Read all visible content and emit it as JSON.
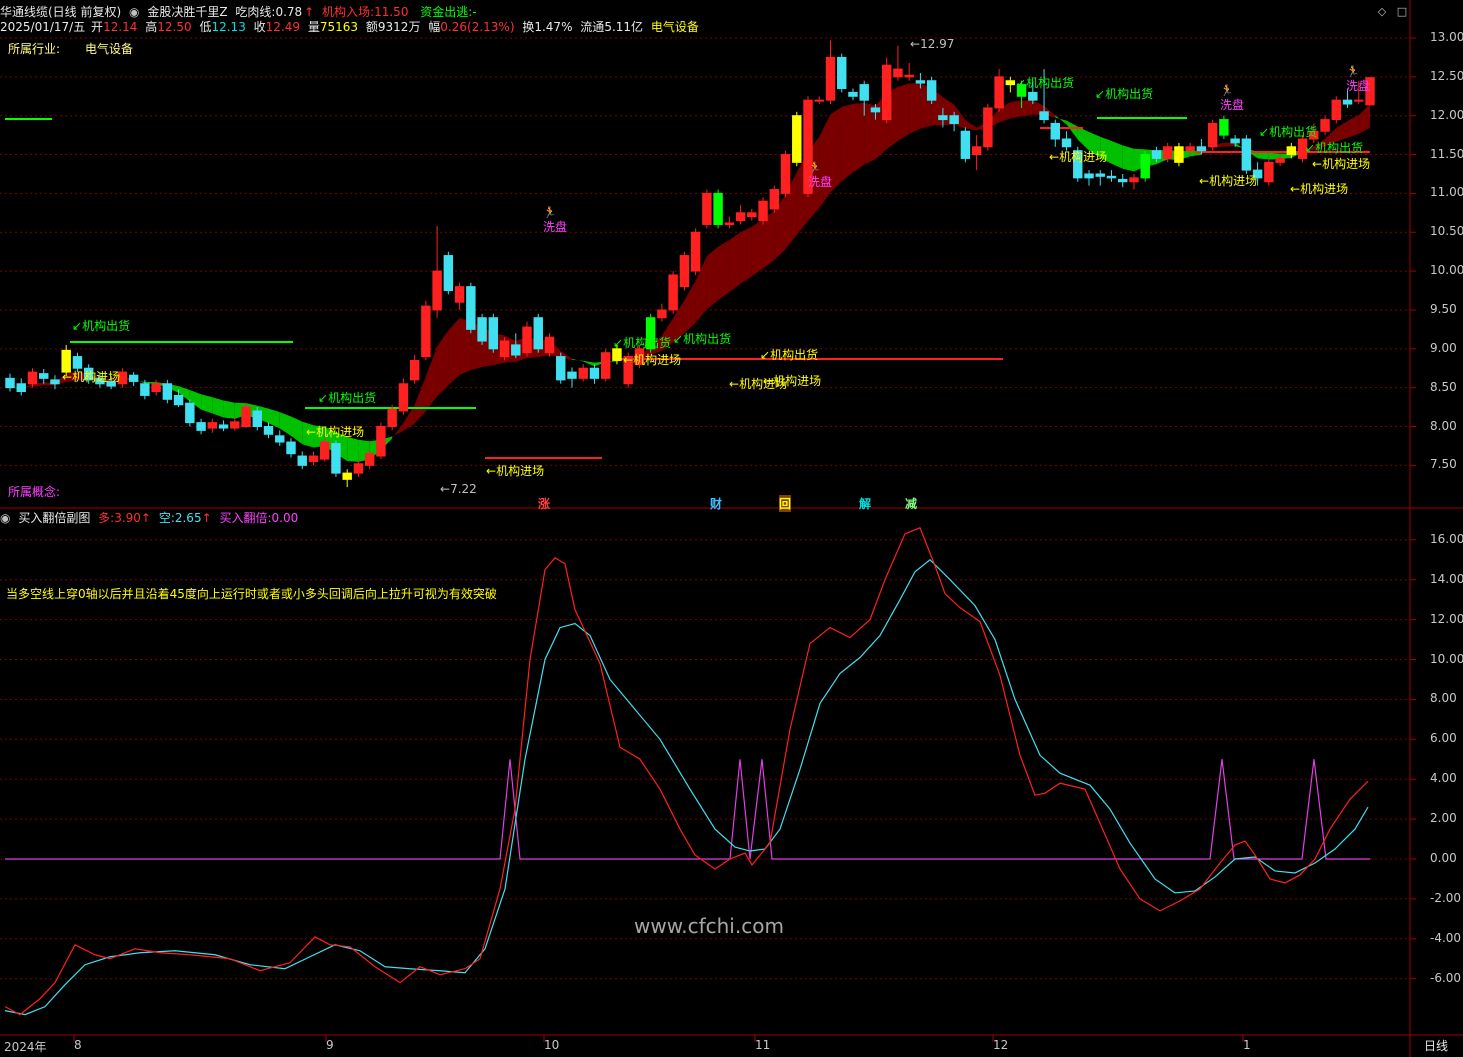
{
  "header": {
    "app_title": "华通线缆(日线 前复权)",
    "indicator_name": "金股决胜千里Z",
    "eat_line_label": "吃肉线:",
    "eat_line_value": "0.78",
    "inst_enter_label": "机构入场:",
    "inst_enter_value": "11.50",
    "fund_exit_label": "资金出逃:",
    "fund_exit_value": "-",
    "date": "2025/01/17/五",
    "open_label": "开",
    "open_value": "12.14",
    "high_label": "高",
    "high_value": "12.50",
    "low_label": "低",
    "low_value": "12.13",
    "close_label": "收",
    "close_value": "12.49",
    "volume_label": "量",
    "volume_value": "75163",
    "amount_label": "额",
    "amount_value": "9312万",
    "change_label": "幅",
    "change_value": "0.26(2.13%)",
    "turnover_label": "换",
    "turnover_value": "1.47%",
    "float_label": "流通",
    "float_value": "5.11亿",
    "sector_inline": "电气设备"
  },
  "info": {
    "industry_label": "所属行业:",
    "industry_value": "电气设备",
    "concept_label": "所属概念:"
  },
  "price_axis": [
    "13.00",
    "12.50",
    "12.00",
    "11.50",
    "11.00",
    "10.50",
    "10.00",
    "9.50",
    "9.00",
    "8.50",
    "8.00",
    "7.50"
  ],
  "sub_panel": {
    "title": "买入翻倍副图",
    "duo_label": "多:",
    "duo_value": "3.90",
    "kong_label": "空:",
    "kong_value": "2.65",
    "buy_double_label": "买入翻倍:",
    "buy_double_value": "0.00",
    "note": "当多空线上穿0轴以后并且沿着45度向上运行时或者或小多头回调后向上拉升可视为有效突破",
    "axis": [
      "16.00",
      "14.00",
      "12.00",
      "10.00",
      "8.00",
      "6.00",
      "4.00",
      "2.00",
      "0.00",
      "-2.00",
      "-4.00",
      "-6.00"
    ]
  },
  "annotations": {
    "low_mark": "7.22",
    "high_mark": "12.97",
    "inst_out": "机构出货",
    "inst_in": "机构进场",
    "wash": "洗盘",
    "events": [
      "涨",
      "财",
      "回",
      "解",
      "减"
    ]
  },
  "date_axis": [
    "2024年",
    "8",
    "9",
    "10",
    "11",
    "12",
    "1"
  ],
  "period": "日线",
  "watermark": "www.cfchi.com",
  "colors": {
    "up": "#ff2020",
    "down": "#40e0f0",
    "band_up": "#7a0000",
    "band_down": "#00c000",
    "signal_yellow": "#ffff00",
    "signal_green": "#00ff00",
    "grid": "#7a0000",
    "purple": "#e040e0"
  },
  "chart_data": {
    "type": "candlestick",
    "candles": [
      [
        8.62,
        8.5,
        8.68,
        8.45
      ],
      [
        8.55,
        8.45,
        8.62,
        8.4
      ],
      [
        8.55,
        8.7,
        8.75,
        8.5
      ],
      [
        8.68,
        8.62,
        8.74,
        8.55
      ],
      [
        8.6,
        8.55,
        8.66,
        8.48
      ],
      [
        8.7,
        8.98,
        9.05,
        8.65
      ],
      [
        8.9,
        8.75,
        8.95,
        8.7
      ],
      [
        8.75,
        8.6,
        8.8,
        8.55
      ],
      [
        8.62,
        8.55,
        8.7,
        8.5
      ],
      [
        8.58,
        8.52,
        8.65,
        8.48
      ],
      [
        8.55,
        8.7,
        8.75,
        8.5
      ],
      [
        8.66,
        8.58,
        8.7,
        8.52
      ],
      [
        8.55,
        8.4,
        8.6,
        8.35
      ],
      [
        8.45,
        8.55,
        8.6,
        8.4
      ],
      [
        8.55,
        8.35,
        8.6,
        8.3
      ],
      [
        8.4,
        8.28,
        8.48,
        8.25
      ],
      [
        8.3,
        8.05,
        8.35,
        8.0
      ],
      [
        8.05,
        7.95,
        8.1,
        7.9
      ],
      [
        7.98,
        8.05,
        8.1,
        7.92
      ],
      [
        8.02,
        7.98,
        8.08,
        7.94
      ],
      [
        7.98,
        8.06,
        8.12,
        7.95
      ],
      [
        8.0,
        8.25,
        8.3,
        7.98
      ],
      [
        8.2,
        8.0,
        8.25,
        7.95
      ],
      [
        8.0,
        7.9,
        8.05,
        7.85
      ],
      [
        7.88,
        7.8,
        7.95,
        7.75
      ],
      [
        7.8,
        7.65,
        7.85,
        7.6
      ],
      [
        7.62,
        7.5,
        7.68,
        7.45
      ],
      [
        7.55,
        7.62,
        7.68,
        7.5
      ],
      [
        7.58,
        7.8,
        7.85,
        7.55
      ],
      [
        7.78,
        7.4,
        7.82,
        7.35
      ],
      [
        7.4,
        7.32,
        7.45,
        7.22
      ],
      [
        7.4,
        7.52,
        7.58,
        7.35
      ],
      [
        7.5,
        7.65,
        7.7,
        7.45
      ],
      [
        7.62,
        8.0,
        8.05,
        7.58
      ],
      [
        8.0,
        8.22,
        8.28,
        7.95
      ],
      [
        8.2,
        8.55,
        8.62,
        8.15
      ],
      [
        8.6,
        8.85,
        8.92,
        8.55
      ],
      [
        8.9,
        9.55,
        9.62,
        8.85
      ],
      [
        9.5,
        10.0,
        10.58,
        9.4
      ],
      [
        10.2,
        9.75,
        10.25,
        9.7
      ],
      [
        9.6,
        9.8,
        9.85,
        9.5
      ],
      [
        9.8,
        9.25,
        9.85,
        9.2
      ],
      [
        9.4,
        9.1,
        9.45,
        9.05
      ],
      [
        9.4,
        9.0,
        9.45,
        8.95
      ],
      [
        8.9,
        9.1,
        9.15,
        8.85
      ],
      [
        9.05,
        8.92,
        9.2,
        8.88
      ],
      [
        8.95,
        9.28,
        9.35,
        8.9
      ],
      [
        9.4,
        9.0,
        9.45,
        8.95
      ],
      [
        8.95,
        9.15,
        9.2,
        8.9
      ],
      [
        8.9,
        8.6,
        8.95,
        8.55
      ],
      [
        8.7,
        8.62,
        8.76,
        8.5
      ],
      [
        8.62,
        8.75,
        8.8,
        8.58
      ],
      [
        8.75,
        8.62,
        8.8,
        8.55
      ],
      [
        8.62,
        8.95,
        9.0,
        8.58
      ],
      [
        9.0,
        8.85,
        9.05,
        8.8
      ],
      [
        8.55,
        8.9,
        8.95,
        8.5
      ],
      [
        8.8,
        9.0,
        9.05,
        8.75
      ],
      [
        9.0,
        9.4,
        9.45,
        8.95
      ],
      [
        9.4,
        9.5,
        9.58,
        9.35
      ],
      [
        9.5,
        9.95,
        10.0,
        9.45
      ],
      [
        9.8,
        10.2,
        10.25,
        9.75
      ],
      [
        10.0,
        10.5,
        10.55,
        9.95
      ],
      [
        10.6,
        11.0,
        11.05,
        10.55
      ],
      [
        11.0,
        10.6,
        11.05,
        10.55
      ],
      [
        10.6,
        10.62,
        10.7,
        10.55
      ],
      [
        10.65,
        10.75,
        10.85,
        10.6
      ],
      [
        10.7,
        10.75,
        10.8,
        10.65
      ],
      [
        10.65,
        10.9,
        10.95,
        10.6
      ],
      [
        10.8,
        11.05,
        11.1,
        10.75
      ],
      [
        11.0,
        11.5,
        11.55,
        10.95
      ],
      [
        11.4,
        12.0,
        12.05,
        11.35
      ],
      [
        11.0,
        12.2,
        12.25,
        10.95
      ],
      [
        12.2,
        12.2,
        12.25,
        12.15
      ],
      [
        12.2,
        12.75,
        12.97,
        12.15
      ],
      [
        12.75,
        12.35,
        12.8,
        12.3
      ],
      [
        12.3,
        12.25,
        12.35,
        12.2
      ],
      [
        12.4,
        12.2,
        12.45,
        12.0
      ],
      [
        12.1,
        12.05,
        12.15,
        11.95
      ],
      [
        11.95,
        12.65,
        12.75,
        11.9
      ],
      [
        12.5,
        12.6,
        12.9,
        12.45
      ],
      [
        12.5,
        12.52,
        12.68,
        12.45
      ],
      [
        12.45,
        12.42,
        12.55,
        12.35
      ],
      [
        12.45,
        12.2,
        12.5,
        12.15
      ],
      [
        12.0,
        11.95,
        12.1,
        11.85
      ],
      [
        12.0,
        11.9,
        12.05,
        11.8
      ],
      [
        11.8,
        11.45,
        11.85,
        11.4
      ],
      [
        11.5,
        11.6,
        11.75,
        11.3
      ],
      [
        11.6,
        12.1,
        12.15,
        11.55
      ],
      [
        12.1,
        12.5,
        12.6,
        12.05
      ],
      [
        12.45,
        12.4,
        12.5,
        12.3
      ],
      [
        12.4,
        12.25,
        12.45,
        12.1
      ],
      [
        12.3,
        12.2,
        12.45,
        12.15
      ],
      [
        12.05,
        11.95,
        12.6,
        11.9
      ],
      [
        11.9,
        11.7,
        11.95,
        11.6
      ],
      [
        11.7,
        11.6,
        11.8,
        11.55
      ],
      [
        11.55,
        11.2,
        11.6,
        11.15
      ],
      [
        11.25,
        11.2,
        11.3,
        11.1
      ],
      [
        11.25,
        11.22,
        11.3,
        11.1
      ],
      [
        11.22,
        11.2,
        11.3,
        11.15
      ],
      [
        11.18,
        11.15,
        11.25,
        11.08
      ],
      [
        11.15,
        11.2,
        11.25,
        11.05
      ],
      [
        11.2,
        11.5,
        11.55,
        11.15
      ],
      [
        11.55,
        11.45,
        11.6,
        11.4
      ],
      [
        11.45,
        11.6,
        11.65,
        11.4
      ],
      [
        11.6,
        11.4,
        11.65,
        11.35
      ],
      [
        11.55,
        11.6,
        11.65,
        11.5
      ],
      [
        11.6,
        11.55,
        11.7,
        11.5
      ],
      [
        11.6,
        11.9,
        11.95,
        11.55
      ],
      [
        11.95,
        11.75,
        12.0,
        11.7
      ],
      [
        11.7,
        11.65,
        11.75,
        11.6
      ],
      [
        11.7,
        11.3,
        11.75,
        11.25
      ],
      [
        11.3,
        11.2,
        11.4,
        11.1
      ],
      [
        11.15,
        11.4,
        11.45,
        11.1
      ],
      [
        11.4,
        11.45,
        11.5,
        11.35
      ],
      [
        11.6,
        11.5,
        11.65,
        11.45
      ],
      [
        11.45,
        11.7,
        11.75,
        11.4
      ],
      [
        11.7,
        11.8,
        11.9,
        11.65
      ],
      [
        11.8,
        11.95,
        12.0,
        11.75
      ],
      [
        11.95,
        12.2,
        12.25,
        11.9
      ],
      [
        12.2,
        12.15,
        12.35,
        12.1
      ],
      [
        12.2,
        12.2,
        12.45,
        12.15
      ],
      [
        12.14,
        12.49,
        12.5,
        12.13
      ]
    ]
  }
}
